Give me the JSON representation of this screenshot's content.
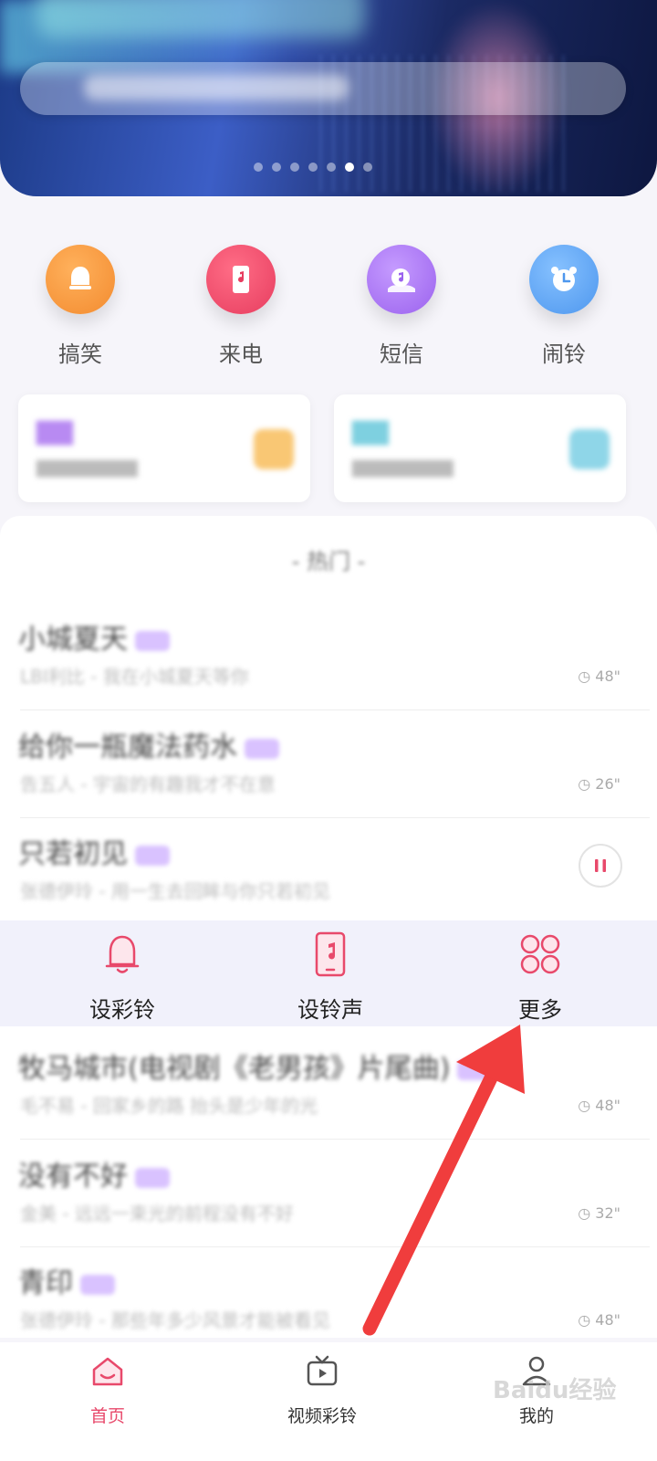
{
  "categories": [
    {
      "label": "搞笑",
      "icon": "bell-icon",
      "color": "#f79a3a"
    },
    {
      "label": "来电",
      "icon": "phone-music-icon",
      "color": "#f0486a"
    },
    {
      "label": "短信",
      "icon": "music-cloud-icon",
      "color": "#a974f2"
    },
    {
      "label": "闹铃",
      "icon": "alarm-clock-icon",
      "color": "#5aa6f2"
    }
  ],
  "section": {
    "title": "- 热门 -"
  },
  "songs": [
    {
      "title": "小城夏天",
      "subtitle": "LBI利比 - 我在小城夏天等你",
      "duration": "48\""
    },
    {
      "title": "给你一瓶魔法药水",
      "subtitle": "告五人 - 宇宙的有趣我才不在意",
      "duration": "26\""
    },
    {
      "title": "只若初见",
      "subtitle": "张德伊玲 - 用一生去回眸与你只若初见",
      "duration": ""
    },
    {
      "title": "牧马城市(电视剧《老男孩》片尾曲)",
      "subtitle": "毛不易 - 回家乡的路 抬头是少年的光",
      "duration": "48\""
    },
    {
      "title": "没有不好",
      "subtitle": "金美 - 远远一束光的前程没有不好",
      "duration": "32\""
    },
    {
      "title": "青印",
      "subtitle": "张德伊玲 - 那些年多少风景才能被看见",
      "duration": "48\""
    }
  ],
  "actions": [
    {
      "label": "设彩铃",
      "icon": "bell-outline-icon"
    },
    {
      "label": "设铃声",
      "icon": "phone-music-outline-icon"
    },
    {
      "label": "更多",
      "icon": "more-circles-icon"
    }
  ],
  "bottom_nav": [
    {
      "label": "首页",
      "icon": "home-icon",
      "active": true
    },
    {
      "label": "视频彩铃",
      "icon": "video-tv-icon",
      "active": false
    },
    {
      "label": "我的",
      "icon": "profile-icon",
      "active": false
    }
  ],
  "watermark": "Baidu经验",
  "colors": {
    "accent": "#e8496b",
    "arrow": "#f03d3d",
    "tag": "#d9c2ff"
  }
}
